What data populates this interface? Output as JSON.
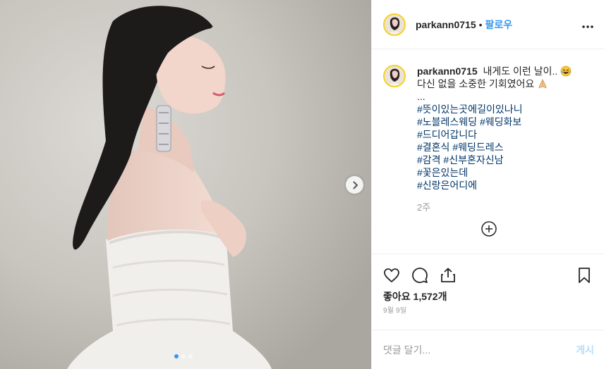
{
  "photo": {
    "next_icon": "chevron-right-icon",
    "dots_count": 3,
    "active_dot": 0
  },
  "header": {
    "username": "parkann0715",
    "separator": "•",
    "follow_label": "팔로우",
    "more_icon": "more-horizontal-icon"
  },
  "caption": {
    "username": "parkann0715",
    "line1": "내게도 이런 날이..",
    "line1_emoji": "rolling-laughing-face",
    "line2": "다신 없을 소중한 기회였어요",
    "line2_emoji": "folded-hands",
    "line3": "...",
    "hashtags": [
      "#뜻이있는곳에길이있나니",
      "#노블레스웨딩 #웨딩화보",
      "#드디어갑니다",
      "#결혼식 #웨딩드레스",
      "#감격 #신부혼자신남",
      "#꽃은있는데",
      "#신랑은어디에"
    ],
    "time": "2주"
  },
  "load_more_icon": "plus-circle-icon",
  "actions": {
    "like_icon": "heart-icon",
    "comment_icon": "comment-icon",
    "share_icon": "share-icon",
    "save_icon": "bookmark-icon"
  },
  "likes_text": "좋아요 1,572개",
  "date_text": "9월 9일",
  "comment": {
    "placeholder": "댓글 달기...",
    "post_label": "게시"
  }
}
